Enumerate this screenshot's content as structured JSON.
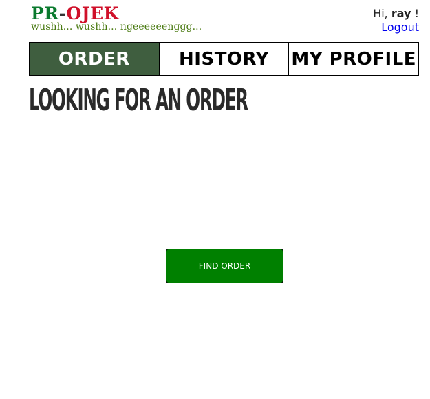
{
  "brand": {
    "pr": "PR",
    "dash": "-",
    "ojek": "OJEK",
    "tagline": "wushh... wushh... ngeeeeeenggg..."
  },
  "user": {
    "greeting": "Hi,",
    "name": "ray",
    "suffix": "!",
    "logout_label": "Logout"
  },
  "nav": {
    "tabs": [
      {
        "label": "ORDER",
        "active": true
      },
      {
        "label": "HISTORY",
        "active": false
      },
      {
        "label": "MY PROFILE",
        "active": false
      }
    ]
  },
  "main": {
    "title": "LOOKING FOR AN ORDER",
    "find_order_label": "FIND ORDER"
  },
  "colors": {
    "brand_green": "#0a7a2e",
    "brand_red": "#d0102a",
    "active_tab": "#3f5e3f",
    "button_green": "#008000",
    "link_blue": "#0000ee"
  }
}
